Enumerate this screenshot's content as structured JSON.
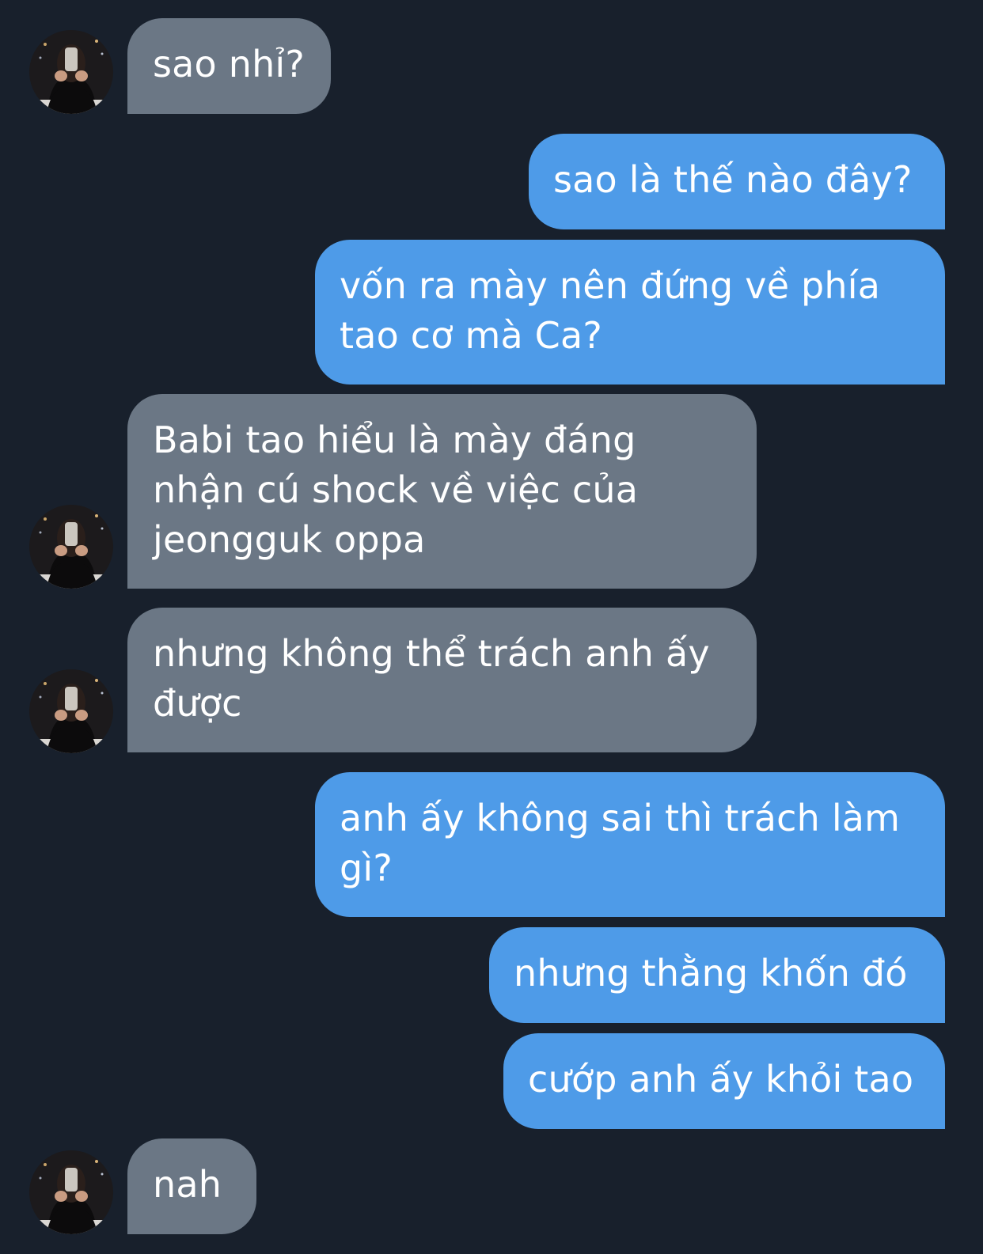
{
  "messages": [
    {
      "side": "in",
      "text": "sao nhỉ?"
    },
    {
      "side": "out",
      "text": "sao là thế nào đây?"
    },
    {
      "side": "out",
      "text": "vốn ra mày nên đứng về phía\ntao cơ mà Ca?"
    },
    {
      "side": "in",
      "text": "Babi tao hiểu là mày đáng\nnhận cú shock về việc của\njeongguk oppa"
    },
    {
      "side": "in",
      "text": "nhưng không thể trách anh ấy\nđược"
    },
    {
      "side": "out",
      "text": "anh ấy không sai thì trách làm\ngì?"
    },
    {
      "side": "out",
      "text": "nhưng thằng khốn đó"
    },
    {
      "side": "out",
      "text": "cướp anh ấy khỏi tao"
    },
    {
      "side": "in",
      "text": "nah"
    }
  ],
  "colors": {
    "background": "#18202c",
    "incoming_bubble": "#6b7785",
    "outgoing_bubble": "#4e9be8",
    "text": "#ffffff"
  },
  "icons": {
    "contact_avatar": "contact-avatar-photo"
  }
}
